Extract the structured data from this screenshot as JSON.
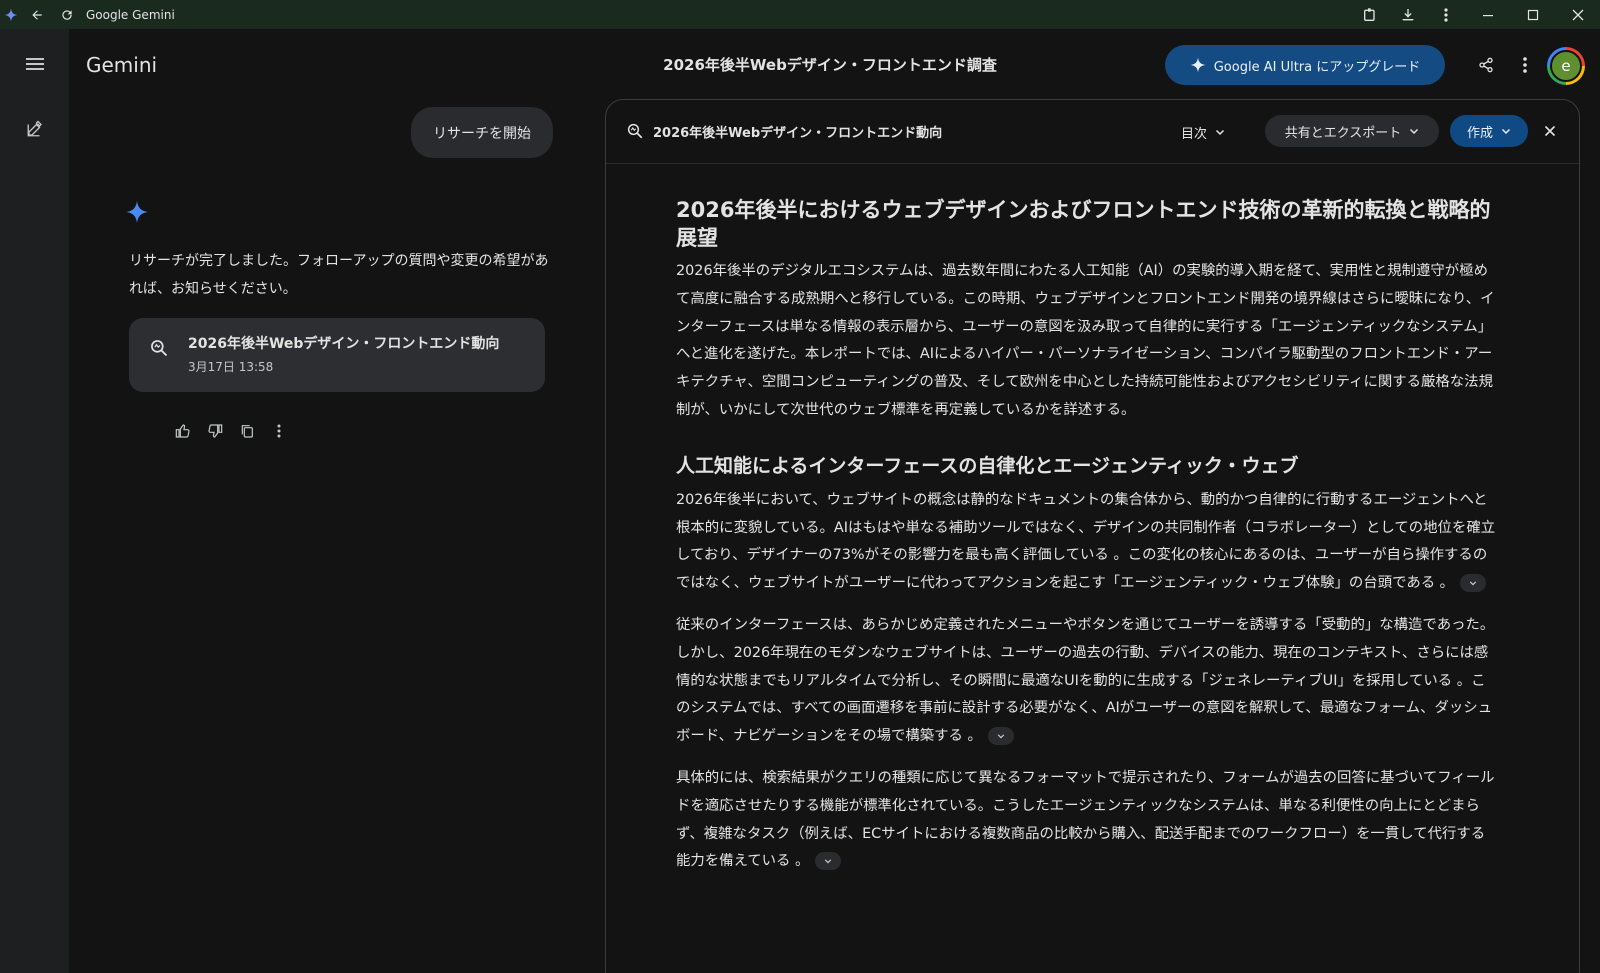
{
  "window": {
    "title": "Google Gemini"
  },
  "header": {
    "brand": "Gemini",
    "title": "2026年後半Webデザイン・フロントエンド調査",
    "upgrade_label": "Google AI Ultra にアップグレード",
    "avatar_letter": "e"
  },
  "chat": {
    "user_message": "リサーチを開始",
    "reply": "リサーチが完了しました。フォローアップの質問や変更の希望があれば、お知らせください。",
    "card": {
      "title": "2026年後半Webデザイン・フロントエンド動向",
      "date": "3月17日 13:58"
    }
  },
  "doc": {
    "bar_title": "2026年後半Webデザイン・フロントエンド動向",
    "toc_label": "目次",
    "share_label": "共有とエクスポート",
    "create_label": "作成",
    "h1": "2026年後半におけるウェブデザインおよびフロントエンド技術の革新的転換と戦略的展望",
    "intro": "2026年後半のデジタルエコシステムは、過去数年間にわたる人工知能（AI）の実験的導入期を経て、実用性と規制遵守が極めて高度に融合する成熟期へと移行している。この時期、ウェブデザインとフロントエンド開発の境界線はさらに曖昧になり、インターフェースは単なる情報の表示層から、ユーザーの意図を汲み取って自律的に実行する「エージェンティックなシステム」へと進化を遂げた。本レポートでは、AIによるハイパー・パーソナライゼーション、コンパイラ駆動型のフロントエンド・アーキテクチャ、空間コンピューティングの普及、そして欧州を中心とした持続可能性およびアクセシビリティに関する厳格な法規制が、いかにして次世代のウェブ標準を再定義しているかを詳述する。",
    "h2": "人工知能によるインターフェースの自律化とエージェンティック・ウェブ",
    "p1": "2026年後半において、ウェブサイトの概念は静的なドキュメントの集合体から、動的かつ自律的に行動するエージェントへと根本的に変貌している。AIはもはや単なる補助ツールではなく、デザインの共同制作者（コラボレーター）としての地位を確立しており、デザイナーの73%がその影響力を最も高く評価している 。この変化の核心にあるのは、ユーザーが自ら操作するのではなく、ウェブサイトがユーザーに代わってアクションを起こす「エージェンティック・ウェブ体験」の台頭である 。",
    "p2": "従来のインターフェースは、あらかじめ定義されたメニューやボタンを通じてユーザーを誘導する「受動的」な構造であった。しかし、2026年現在のモダンなウェブサイトは、ユーザーの過去の行動、デバイスの能力、現在のコンテキスト、さらには感情的な状態までもリアルタイムで分析し、その瞬間に最適なUIを動的に生成する「ジェネレーティブUI」を採用している 。このシステムでは、すべての画面遷移を事前に設計する必要がなく、AIがユーザーの意図を解釈して、最適なフォーム、ダッシュボード、ナビゲーションをその場で構築する 。",
    "p3": "具体的には、検索結果がクエリの種類に応じて異なるフォーマットで提示されたり、フォームが過去の回答に基づいてフィールドを適応させたりする機能が標準化されている。こうしたエージェンティックなシステムは、単なる利便性の向上にとどまらず、複雑なタスク（例えば、ECサイトにおける複数商品の比較から購入、配送手配までのワークフロー）を一貫して代行する能力を備えている 。"
  },
  "colors": {
    "accent": "#0f4a85",
    "background": "#131314",
    "rail": "#1e1f20"
  }
}
